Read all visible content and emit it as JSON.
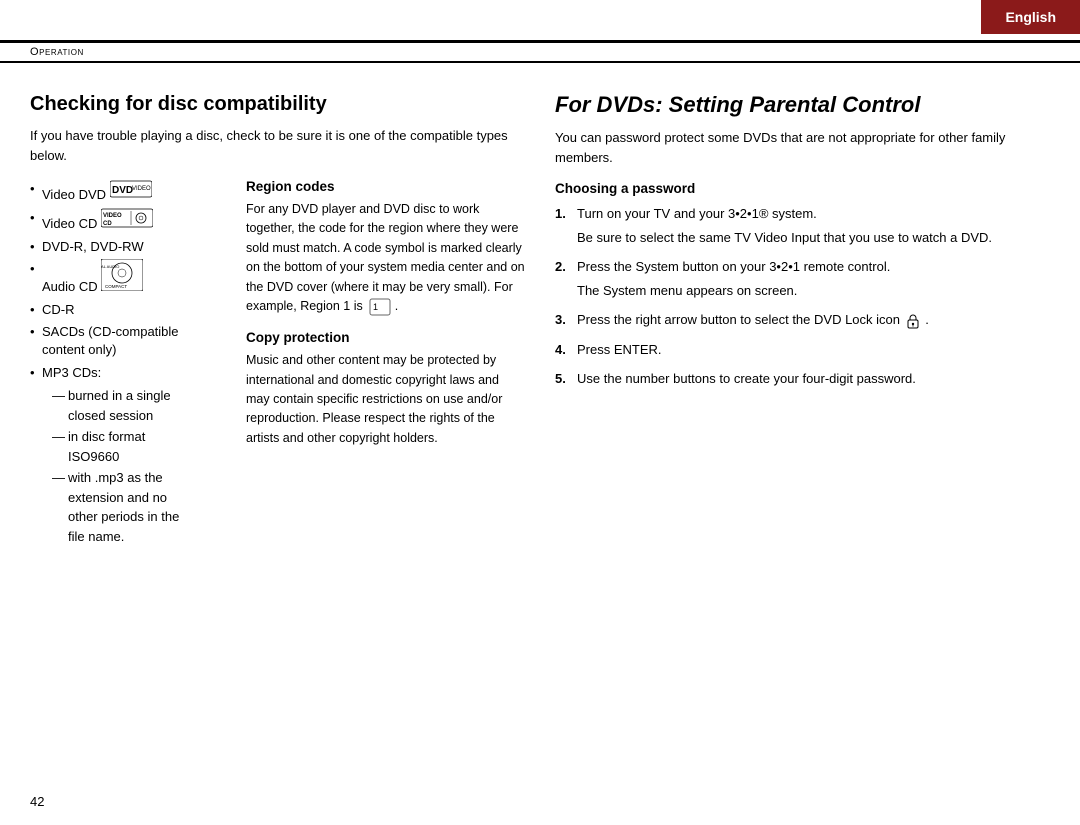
{
  "language_tab": {
    "label": "English"
  },
  "operation_header": {
    "label": "Operation"
  },
  "left_section": {
    "title": "Checking for disc compatibility",
    "intro": "If you have trouble playing a disc, check to be sure it is one of the compatible types below.",
    "disc_list": [
      {
        "label": "Video DVD",
        "has_icon": "dvd"
      },
      {
        "label": "Video CD",
        "has_icon": "videocd"
      },
      {
        "label": "DVD-R, DVD-RW",
        "has_icon": null
      },
      {
        "label": "Audio CD",
        "has_icon": "compactdisc"
      },
      {
        "label": "CD-R",
        "has_icon": null
      },
      {
        "label": "SACDs (CD-compatible content only)",
        "has_icon": null
      },
      {
        "label": "MP3 CDs:",
        "has_icon": null,
        "subitems": [
          "burned in a single closed session",
          "in disc format ISO9660",
          "with .mp3 as the extension and no other periods in the file name."
        ]
      }
    ],
    "region_codes": {
      "title": "Region codes",
      "body": "For any DVD player and DVD disc to work together, the code for the region where they were sold must match. A code symbol is marked clearly on the bottom of your system media center and on the DVD cover (where it may be very small). For example, Region 1 is"
    },
    "copy_protection": {
      "title": "Copy protection",
      "body": "Music and other content may be protected by international and domestic copyright laws and may contain specific restrictions on use and/or reproduction. Please respect the rights of the artists and other copyright holders."
    }
  },
  "right_section": {
    "title": "For DVDs: Setting Parental Control",
    "intro": "You can password protect some DVDs that are not appropriate for other family members.",
    "choosing_password": {
      "subtitle": "Choosing a password",
      "steps": [
        {
          "num": "1.",
          "main": "Turn on your TV and your 3•2•1® system.",
          "note": "Be sure to select the same TV Video Input that you use to watch a DVD."
        },
        {
          "num": "2.",
          "main": "Press the System button on your 3•2•1 remote control.",
          "note": "The System menu appears on screen."
        },
        {
          "num": "3.",
          "main": "Press the right arrow button to select the DVD Lock icon",
          "note": null
        },
        {
          "num": "4.",
          "main": "Press ENTER.",
          "note": null
        },
        {
          "num": "5.",
          "main": "Use the number buttons to create your four-digit password.",
          "note": null
        }
      ]
    }
  },
  "page_number": "42"
}
